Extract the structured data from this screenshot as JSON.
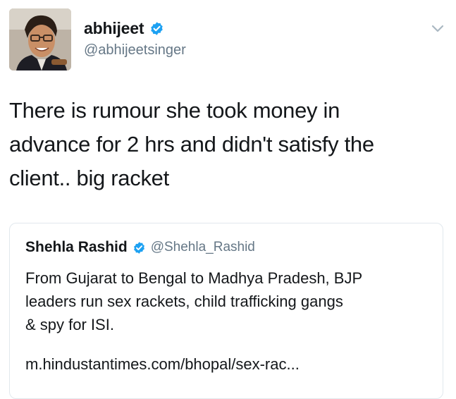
{
  "author": {
    "display_name": "abhijeet",
    "handle": "@abhijeetsinger",
    "verified": true
  },
  "tweet": {
    "text_lines": [
      "There is rumour she took money in",
      "advance for 2 hrs and didn't satisfy the",
      "client.. big racket"
    ]
  },
  "quoted_tweet": {
    "display_name": "Shehla Rashid",
    "handle": "@Shehla_Rashid",
    "verified": true,
    "text_lines": [
      "From Gujarat to Bengal to Madhya Pradesh, BJP",
      "leaders run sex rackets, child trafficking gangs",
      "& spy for ISI."
    ],
    "link": "m.hindustantimes.com/bhopal/sex-rac..."
  },
  "icons": {
    "verified": "verified-badge-icon",
    "menu": "chevron-down-icon"
  },
  "colors": {
    "verified_blue": "#1da1f2",
    "handle_gray": "#657786",
    "border": "#e1e8ed"
  }
}
